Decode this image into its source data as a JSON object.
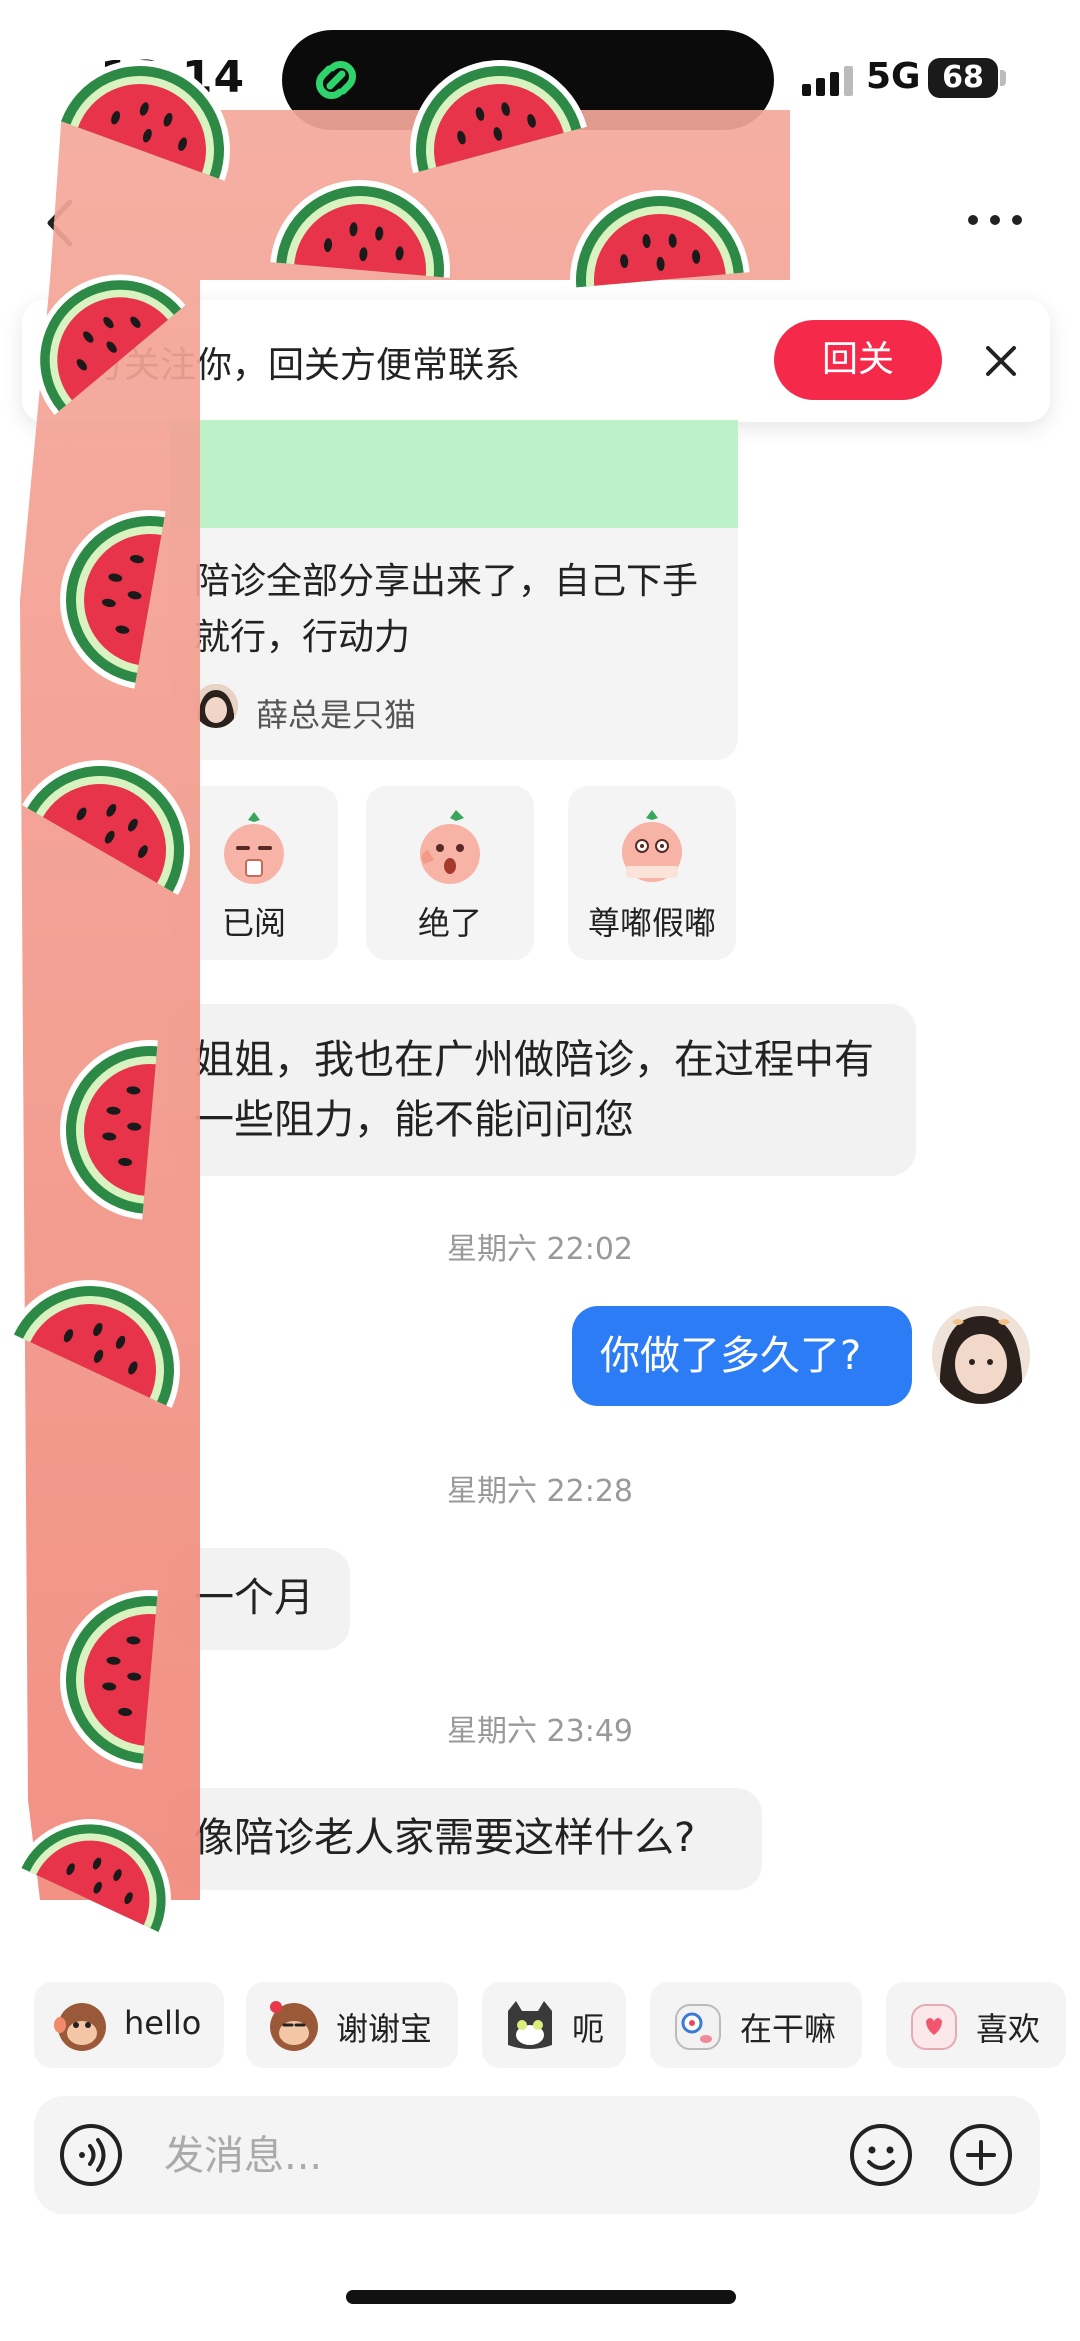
{
  "status_bar": {
    "time": "13:14",
    "network": "5G",
    "battery": "68"
  },
  "follow_banner": {
    "text": "对方关注你，回关方便常联系",
    "button": "回关"
  },
  "shared_card": {
    "title": "陪诊全部分享出来了，自己下手就行，行动力",
    "author": "薛总是只猫"
  },
  "reactions": [
    {
      "label": "已阅",
      "icon": "sticker-read-icon"
    },
    {
      "label": "绝了",
      "icon": "sticker-awesome-icon"
    },
    {
      "label": "尊嘟假嘟",
      "icon": "sticker-really-icon"
    }
  ],
  "messages": [
    {
      "type": "in",
      "text": "姐姐，我也在广州做陪诊，在过程中有一些阻力，能不能问问您"
    },
    {
      "type": "time",
      "text": "星期六 22:02"
    },
    {
      "type": "out",
      "text": "你做了多久了?"
    },
    {
      "type": "time",
      "text": "星期六 22:28"
    },
    {
      "type": "in",
      "text": "一个月"
    },
    {
      "type": "time",
      "text": "星期六 23:49"
    },
    {
      "type": "in",
      "text": "像陪诊老人家需要这样什么?"
    }
  ],
  "quick_replies": [
    {
      "label": "hello",
      "icon": "monkey-hello-icon"
    },
    {
      "label": "谢谢宝",
      "icon": "monkey-thanks-icon"
    },
    {
      "label": "呃",
      "icon": "cat-uh-icon"
    },
    {
      "label": "在干嘛",
      "icon": "sticker-what-doing-icon"
    },
    {
      "label": "喜欢",
      "icon": "sticker-like-icon"
    }
  ],
  "input": {
    "placeholder": "发消息..."
  },
  "colors": {
    "accent_red": "#f52a4a",
    "outgoing_bubble": "#2b7cf5",
    "incoming_bubble": "#f2f2f2",
    "card_image": "#bdf2c8"
  }
}
